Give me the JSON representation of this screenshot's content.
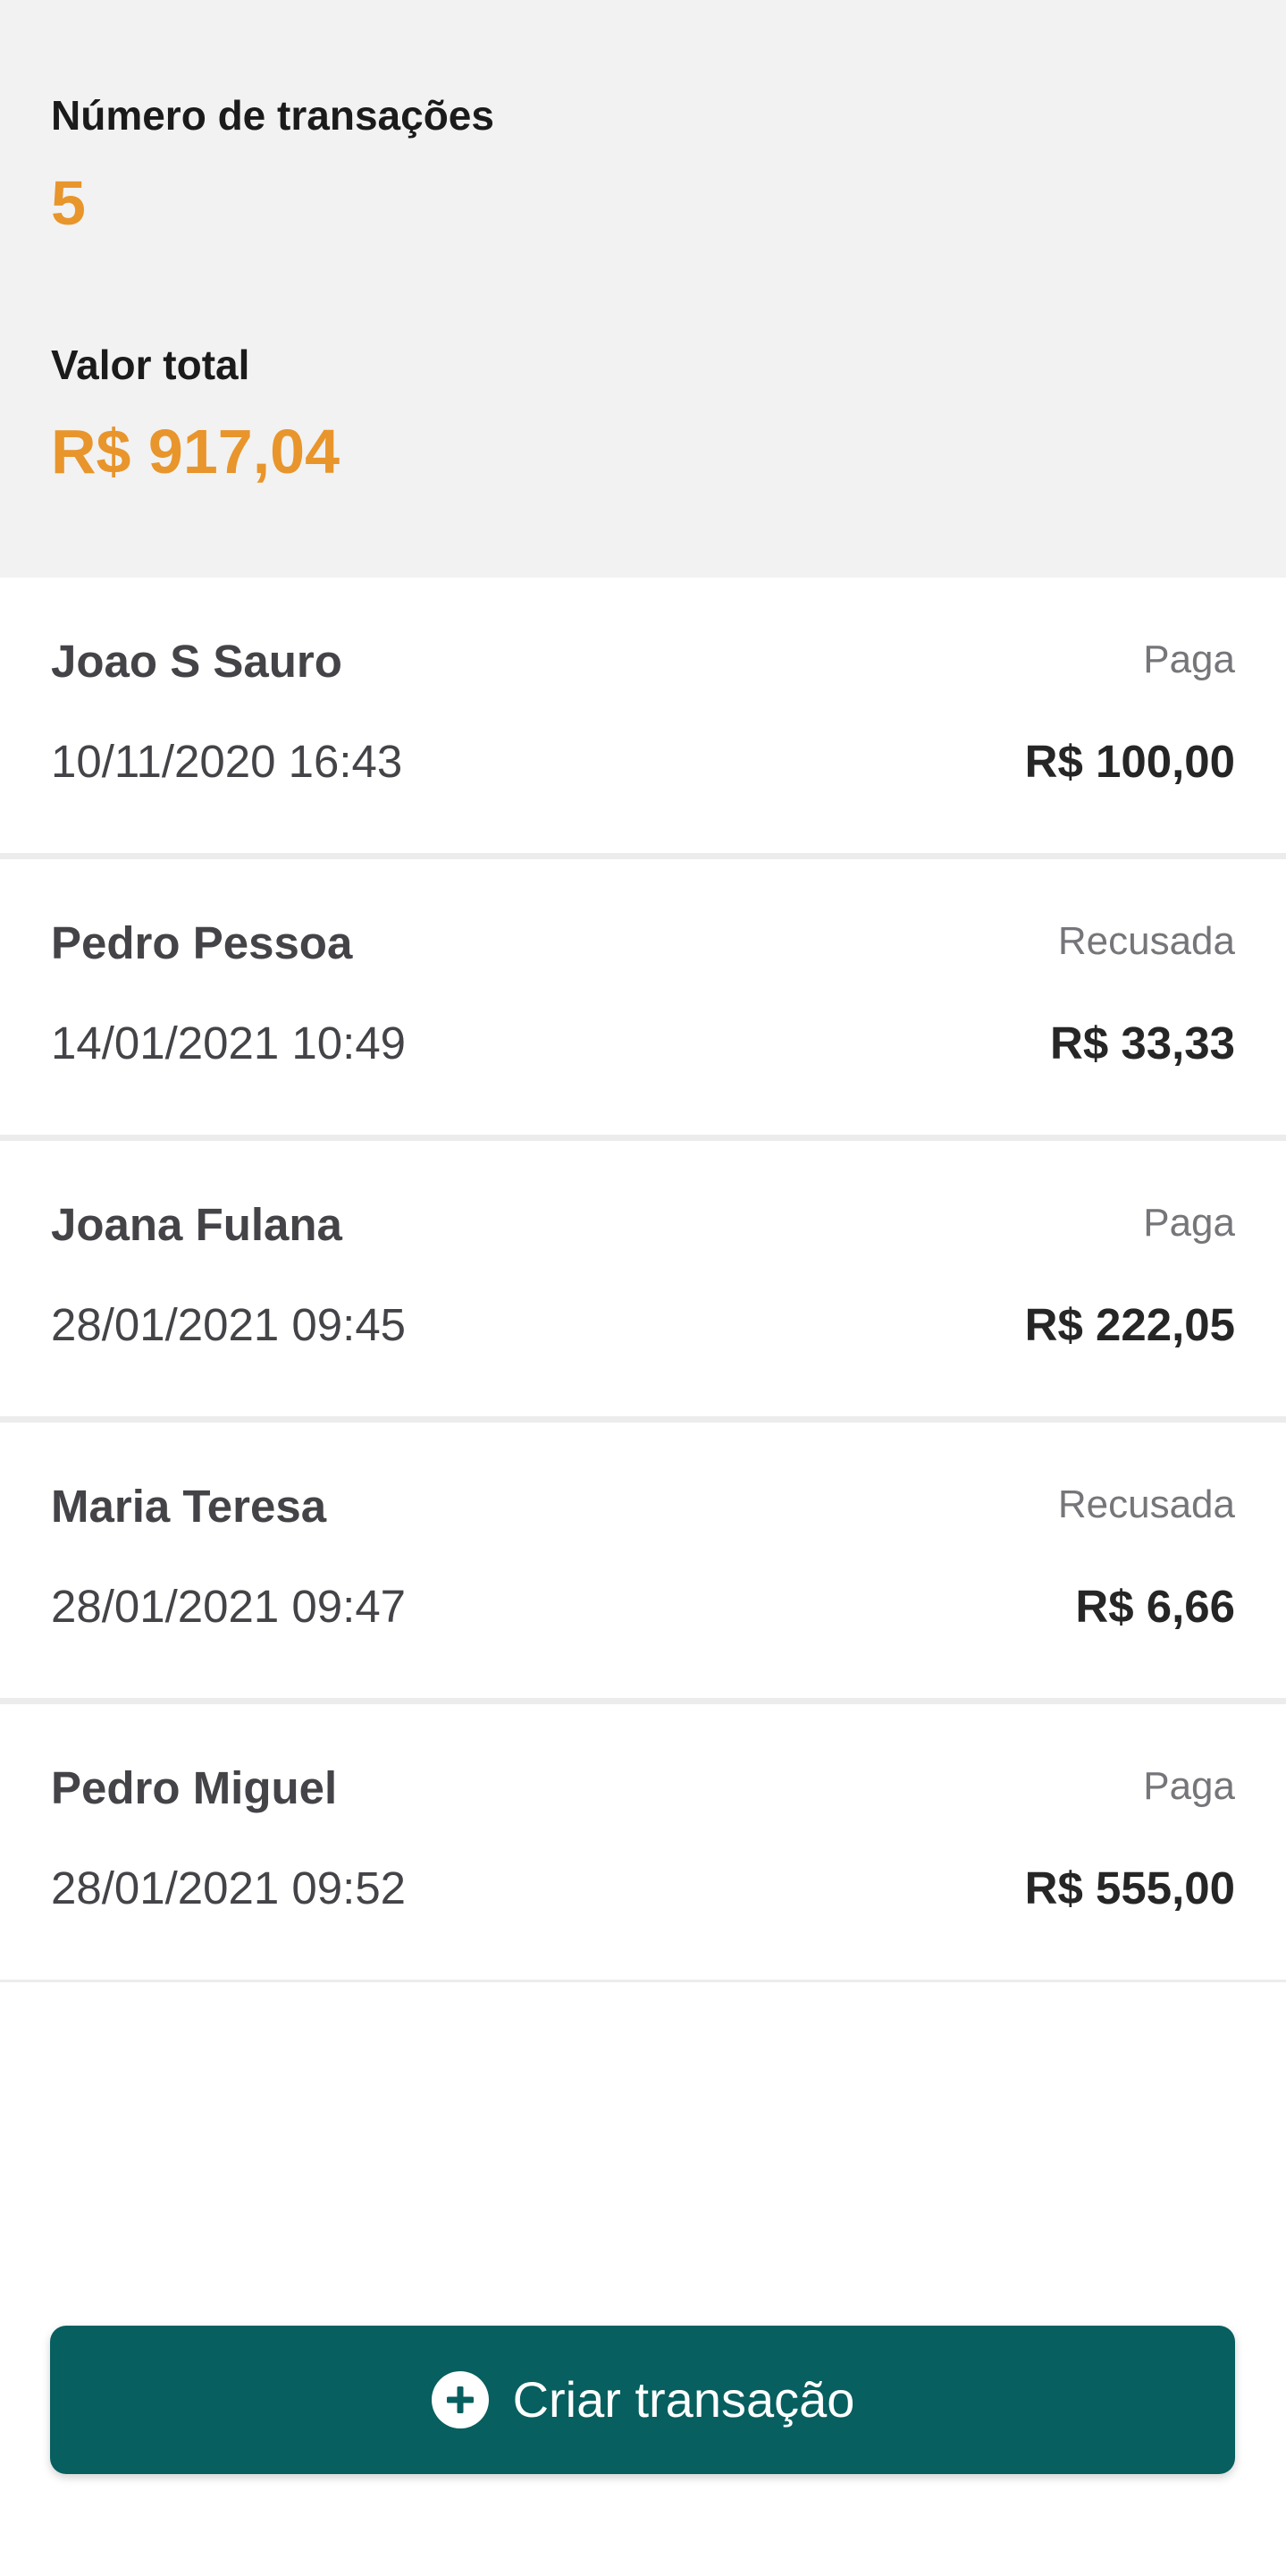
{
  "summary": {
    "count_label": "Número de transações",
    "count_value": "5",
    "total_label": "Valor total",
    "total_value": "R$ 917,04"
  },
  "transactions": [
    {
      "name": "Joao S Sauro",
      "status": "Paga",
      "date": "10/11/2020 16:43",
      "amount": "R$ 100,00"
    },
    {
      "name": "Pedro Pessoa",
      "status": "Recusada",
      "date": "14/01/2021 10:49",
      "amount": "R$ 33,33"
    },
    {
      "name": "Joana Fulana",
      "status": "Paga",
      "date": "28/01/2021 09:45",
      "amount": "R$ 222,05"
    },
    {
      "name": "Maria Teresa",
      "status": "Recusada",
      "date": "28/01/2021 09:47",
      "amount": "R$ 6,66"
    },
    {
      "name": "Pedro Miguel",
      "status": "Paga",
      "date": "28/01/2021 09:52",
      "amount": "R$ 555,00"
    }
  ],
  "create_button": {
    "label": "Criar transação",
    "icon": "plus-circle-icon"
  },
  "colors": {
    "accent": "#e8952c",
    "primary": "#075f5f",
    "summary_bg": "#f2f2f2"
  }
}
